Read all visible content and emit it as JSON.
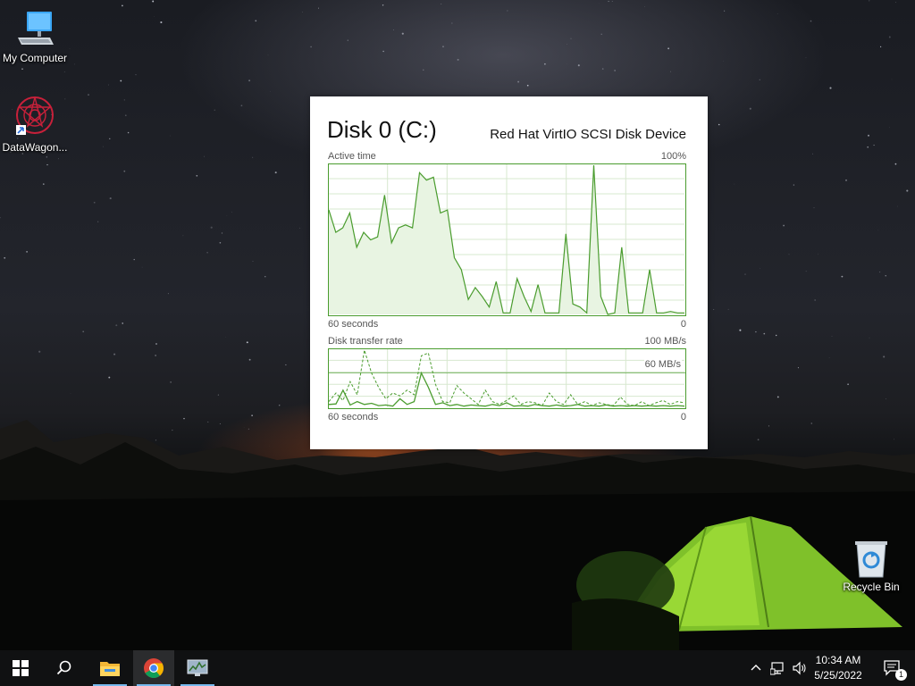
{
  "desktop": {
    "icons": [
      {
        "label": "My Computer",
        "icon": "computer-icon"
      },
      {
        "label": "DataWagon...",
        "icon": "datawagon-icon"
      },
      {
        "label": "Recycle Bin",
        "icon": "recycle-bin-icon"
      }
    ]
  },
  "widget": {
    "title": "Disk 0 (C:)",
    "device": "Red Hat VirtIO SCSI Disk Device",
    "active_time": {
      "label": "Active time",
      "max_label": "100%",
      "time_label": "60 seconds",
      "min_label": "0",
      "values": [
        70,
        55,
        58,
        68,
        45,
        55,
        50,
        52,
        80,
        48,
        58,
        60,
        58,
        95,
        90,
        92,
        68,
        70,
        38,
        30,
        10,
        18,
        12,
        5,
        22,
        1,
        1,
        24,
        12,
        2,
        20,
        1,
        1,
        1,
        54,
        7,
        5,
        1,
        100,
        12,
        0,
        1,
        45,
        1,
        1,
        1,
        30,
        1,
        1,
        2,
        1,
        1
      ]
    },
    "transfer_rate": {
      "label": "Disk transfer rate",
      "max_label": "100 MB/s",
      "ref_label": "60 MB/s",
      "time_label": "60 seconds",
      "min_label": "0",
      "read_values": [
        5,
        6,
        30,
        4,
        10,
        5,
        7,
        3,
        4,
        2,
        15,
        5,
        10,
        60,
        35,
        5,
        8,
        3,
        5,
        2,
        4,
        3,
        2,
        5,
        3,
        8,
        2,
        3,
        2,
        5,
        3,
        2,
        4,
        2,
        3,
        5,
        2,
        3,
        2,
        4,
        2,
        3,
        2,
        3,
        2,
        3,
        2,
        3,
        2,
        3,
        2
      ],
      "write_values": [
        10,
        25,
        12,
        45,
        22,
        100,
        60,
        35,
        15,
        25,
        20,
        30,
        22,
        90,
        95,
        40,
        10,
        8,
        38,
        25,
        15,
        5,
        30,
        10,
        5,
        12,
        20,
        5,
        10,
        8,
        3,
        25,
        10,
        5,
        22,
        5,
        10,
        3,
        8,
        5,
        3,
        18,
        5,
        3,
        10,
        3,
        8,
        12,
        5,
        10,
        8
      ],
      "accent_color": "#4a9c2e"
    }
  },
  "taskbar": {
    "apps": [
      {
        "name": "start-button",
        "icon": "windows-icon"
      },
      {
        "name": "search-button",
        "icon": "search-icon"
      },
      {
        "name": "file-explorer",
        "icon": "folder-icon"
      },
      {
        "name": "chrome",
        "icon": "chrome-icon"
      },
      {
        "name": "resource-monitor",
        "icon": "monitor-icon"
      }
    ],
    "time": "10:34 AM",
    "date": "5/25/2022",
    "notifications": "1"
  }
}
